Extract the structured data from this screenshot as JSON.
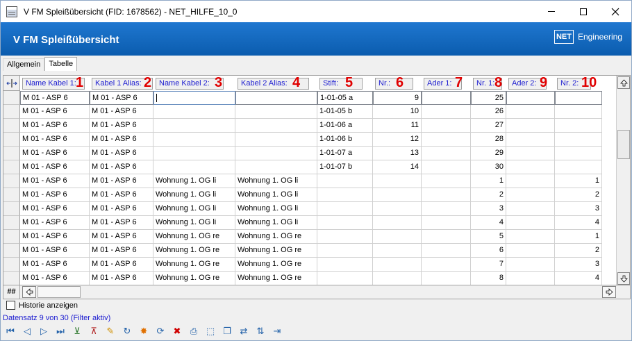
{
  "window": {
    "title": "V FM Spleißübersicht (FID: 1678562) - NET_HILFE_10_0"
  },
  "header": {
    "title": "V FM Spleißübersicht",
    "brand_logo": "NET",
    "brand_text": "Engineering"
  },
  "tabs": [
    {
      "label": "Allgemein"
    },
    {
      "label": "Tabelle"
    }
  ],
  "columns": [
    {
      "label": "Name Kabel 1:",
      "num": "1"
    },
    {
      "label": "Kabel 1 Alias:",
      "num": "2"
    },
    {
      "label": "Name Kabel 2:",
      "num": "3"
    },
    {
      "label": "Kabel 2 Alias:",
      "num": "4"
    },
    {
      "label": "Stift:",
      "num": "5"
    },
    {
      "label": "Nr.:",
      "num": "6"
    },
    {
      "label": "Ader 1:",
      "num": "7"
    },
    {
      "label": "Nr. 1:",
      "num": "8"
    },
    {
      "label": "Ader 2:",
      "num": "9"
    },
    {
      "label": "Nr. 2:",
      "num": "10"
    }
  ],
  "rows": [
    [
      "M 01 - ASP 6",
      "M 01 - ASP 6",
      "",
      "",
      "1-01-05 a",
      "9",
      "",
      "25",
      "",
      ""
    ],
    [
      "M 01 - ASP 6",
      "M 01 - ASP 6",
      "",
      "",
      "1-01-05 b",
      "10",
      "",
      "26",
      "",
      ""
    ],
    [
      "M 01 - ASP 6",
      "M 01 - ASP 6",
      "",
      "",
      "1-01-06 a",
      "11",
      "",
      "27",
      "",
      ""
    ],
    [
      "M 01 - ASP 6",
      "M 01 - ASP 6",
      "",
      "",
      "1-01-06 b",
      "12",
      "",
      "28",
      "",
      ""
    ],
    [
      "M 01 - ASP 6",
      "M 01 - ASP 6",
      "",
      "",
      "1-01-07 a",
      "13",
      "",
      "29",
      "",
      ""
    ],
    [
      "M 01 - ASP 6",
      "M 01 - ASP 6",
      "",
      "",
      "1-01-07 b",
      "14",
      "",
      "30",
      "",
      ""
    ],
    [
      "M 01 - ASP 6",
      "M 01 - ASP 6",
      "Wohnung 1. OG li",
      "Wohnung 1. OG li",
      "",
      "",
      "",
      "1",
      "",
      "1"
    ],
    [
      "M 01 - ASP 6",
      "M 01 - ASP 6",
      "Wohnung 1. OG li",
      "Wohnung 1. OG li",
      "",
      "",
      "",
      "2",
      "",
      "2"
    ],
    [
      "M 01 - ASP 6",
      "M 01 - ASP 6",
      "Wohnung 1. OG li",
      "Wohnung 1. OG li",
      "",
      "",
      "",
      "3",
      "",
      "3"
    ],
    [
      "M 01 - ASP 6",
      "M 01 - ASP 6",
      "Wohnung 1. OG li",
      "Wohnung 1. OG li",
      "",
      "",
      "",
      "4",
      "",
      "4"
    ],
    [
      "M 01 - ASP 6",
      "M 01 - ASP 6",
      "Wohnung 1. OG re",
      "Wohnung 1. OG re",
      "",
      "",
      "",
      "5",
      "",
      "1"
    ],
    [
      "M 01 - ASP 6",
      "M 01 - ASP 6",
      "Wohnung 1. OG re",
      "Wohnung 1. OG re",
      "",
      "",
      "",
      "6",
      "",
      "2"
    ],
    [
      "M 01 - ASP 6",
      "M 01 - ASP 6",
      "Wohnung 1. OG re",
      "Wohnung 1. OG re",
      "",
      "",
      "",
      "7",
      "",
      "3"
    ],
    [
      "M 01 - ASP 6",
      "M 01 - ASP 6",
      "Wohnung 1. OG re",
      "Wohnung 1. OG re",
      "",
      "",
      "",
      "8",
      "",
      "4"
    ]
  ],
  "grid": {
    "corner_label": "##",
    "column_sizer_icon": "column-resize-icon"
  },
  "footer": {
    "history_checkbox_label": "Historie anzeigen",
    "history_checked": false,
    "status": "Datensatz 9 von 30 (Filter aktiv)"
  },
  "toolbar_icons": [
    "first-record-icon",
    "previous-record-icon",
    "next-record-icon",
    "last-record-icon",
    "add-filter-icon",
    "remove-filter-icon",
    "edit-icon",
    "refresh-icon",
    "new-record-icon",
    "sync-icon",
    "delete-icon",
    "print-icon",
    "select-all-icon",
    "copy-icon",
    "network-icon",
    "sort-icon",
    "exit-icon"
  ]
}
